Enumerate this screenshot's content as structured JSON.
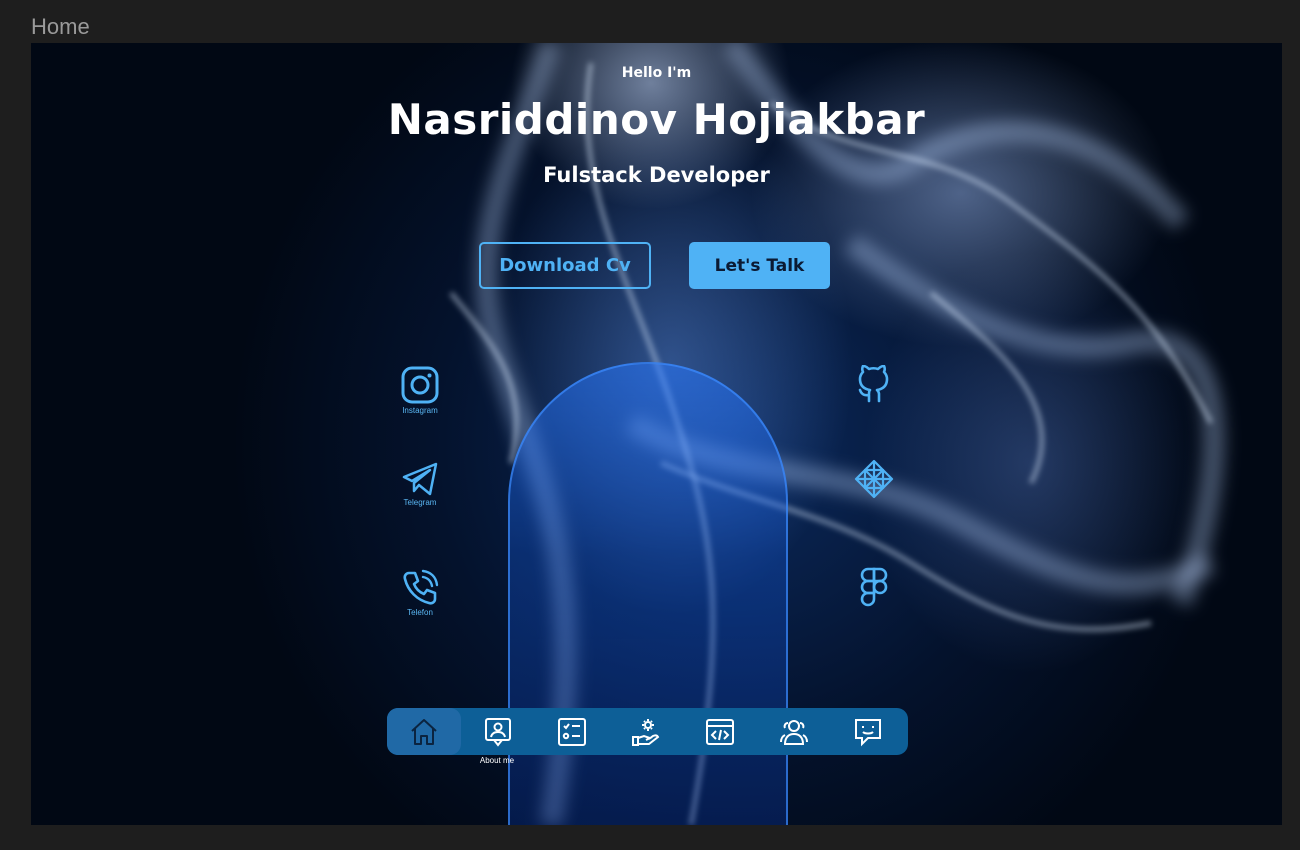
{
  "frame": {
    "label": "Home"
  },
  "hero": {
    "greeting": "Hello I'm",
    "name": "Nasriddinov Hojiakbar",
    "role": "Fulstack Developer"
  },
  "buttons": {
    "download": "Download Cv",
    "talk": "Let's Talk"
  },
  "socials_left": [
    {
      "icon": "instagram-icon",
      "label": "Instagram"
    },
    {
      "icon": "telegram-icon",
      "label": "Telegram"
    },
    {
      "icon": "phone-icon",
      "label": "Telefon"
    }
  ],
  "socials_right": [
    {
      "icon": "github-icon"
    },
    {
      "icon": "codepen-icon"
    },
    {
      "icon": "figma-icon"
    }
  ],
  "nav": {
    "items": [
      {
        "icon": "home-icon",
        "active": true
      },
      {
        "icon": "about-me-icon"
      },
      {
        "icon": "checklist-icon"
      },
      {
        "icon": "services-icon"
      },
      {
        "icon": "code-icon"
      },
      {
        "icon": "users-icon"
      },
      {
        "icon": "chat-icon"
      }
    ],
    "hover_caption": "About me"
  },
  "colors": {
    "accent": "#4fb2f5",
    "nav_bg": "#0d5f97",
    "page_bg": "#1e1e1e",
    "text": "#ffffff"
  }
}
